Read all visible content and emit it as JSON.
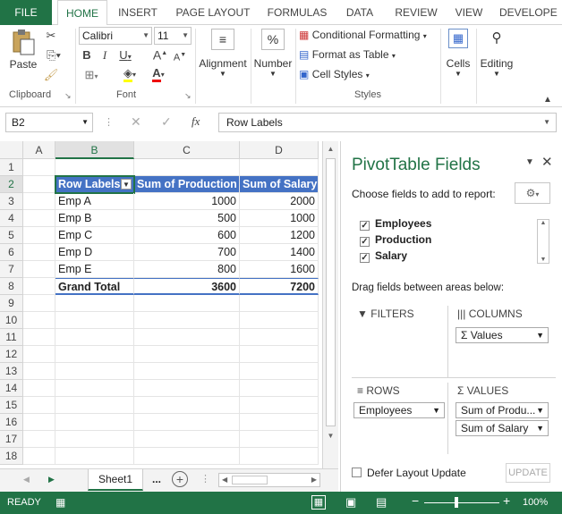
{
  "ribbon_tabs": [
    "FILE",
    "HOME",
    "INSERT",
    "PAGE LAYOUT",
    "FORMULAS",
    "DATA",
    "REVIEW",
    "VIEW",
    "DEVELOPE"
  ],
  "clipboard": {
    "paste": "Paste",
    "label": "Clipboard"
  },
  "font": {
    "name": "Calibri",
    "size": "11",
    "label": "Font"
  },
  "alignment": {
    "label": "Alignment"
  },
  "number": {
    "label": "Number",
    "symbol": "%"
  },
  "styles": {
    "cond": "Conditional Formatting",
    "table": "Format as Table",
    "cell": "Cell Styles",
    "label": "Styles"
  },
  "cells": {
    "label": "Cells"
  },
  "editing": {
    "label": "Editing"
  },
  "formula_bar": {
    "name_box": "B2",
    "value": "Row Labels",
    "fx": "fx"
  },
  "columns": [
    "A",
    "B",
    "C",
    "D"
  ],
  "rows": [
    "1",
    "2",
    "3",
    "4",
    "5",
    "6",
    "7",
    "8",
    "9",
    "10",
    "11",
    "12",
    "13",
    "14",
    "15",
    "16",
    "17",
    "18"
  ],
  "pivot": {
    "headers": [
      "Row Labels",
      "Sum of Production",
      "Sum of Salary"
    ],
    "data": [
      [
        "Emp A",
        "1000",
        "2000"
      ],
      [
        "Emp B",
        "500",
        "1000"
      ],
      [
        "Emp C",
        "600",
        "1200"
      ],
      [
        "Emp D",
        "700",
        "1400"
      ],
      [
        "Emp E",
        "800",
        "1600"
      ]
    ],
    "total": [
      "Grand Total",
      "3600",
      "7200"
    ]
  },
  "sheet": {
    "tab": "Sheet1",
    "more": "..."
  },
  "pane": {
    "title": "PivotTable Fields",
    "choose": "Choose fields to add to report:",
    "fields": [
      "Employees",
      "Production",
      "Salary"
    ],
    "drag": "Drag fields between areas below:",
    "filters": "FILTERS",
    "columns": "COLUMNS",
    "columns_item": "Values",
    "rows": "ROWS",
    "rows_item": "Employees",
    "values": "VALUES",
    "values_items": [
      "Sum of Produ...",
      "Sum of Salary"
    ],
    "defer": "Defer Layout Update",
    "update": "UPDATE"
  },
  "status": {
    "ready": "READY",
    "zoom": "100%"
  }
}
